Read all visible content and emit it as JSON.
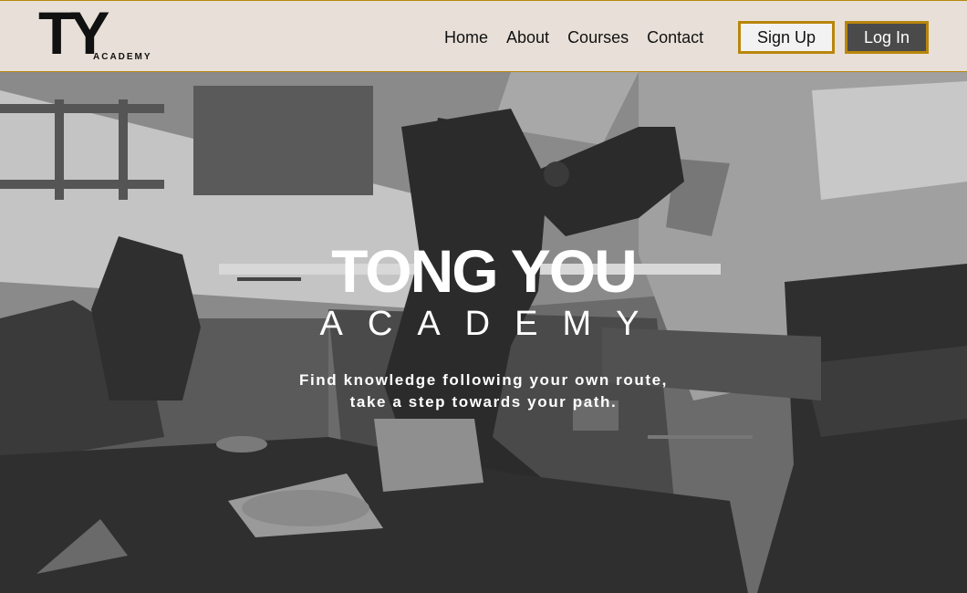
{
  "logo": {
    "letters": "TY",
    "sub": "ACADEMY"
  },
  "nav": {
    "links": [
      "Home",
      "About",
      "Courses",
      "Contact"
    ]
  },
  "buttons": {
    "signup": "Sign Up",
    "login": "Log In"
  },
  "hero": {
    "title": "TONG YOU",
    "subtitle": "ACADEMY",
    "tagline_line1": "Find knowledge following your own route,",
    "tagline_line2": "take a step towards your path."
  },
  "colors": {
    "nav_bg": "#e8e0d8",
    "accent": "#b8860b",
    "login_bg": "#4a4a4a"
  }
}
